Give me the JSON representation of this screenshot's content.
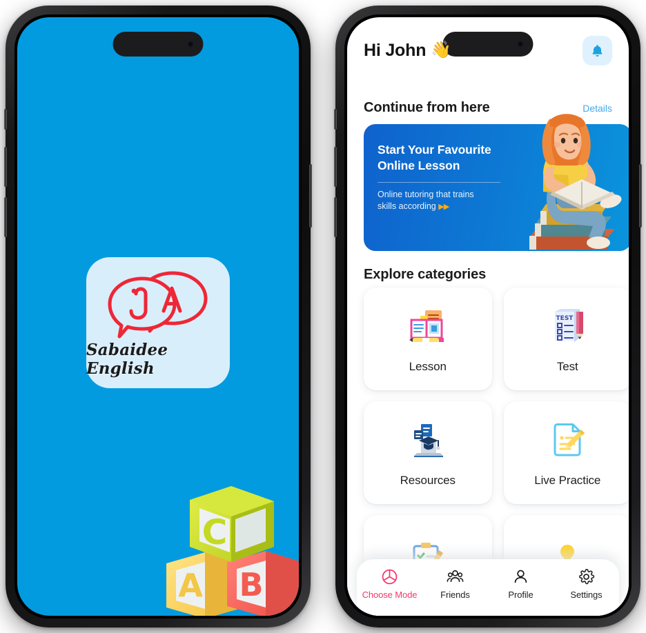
{
  "colors": {
    "splash_bg": "#039BE0",
    "logo_card_bg": "#d9eefb",
    "logo_red": "#ee2737",
    "banner_from": "#0f62cd",
    "banner_to": "#0a95dd",
    "accent_pink": "#f5376b",
    "link_blue": "#3fa9ee",
    "bell_bg": "#dff1fd",
    "arrow_amber": "#ffab14"
  },
  "splash": {
    "app_name": "Sabaidee English",
    "logo_letter_lao": "ບ",
    "logo_letter_en": "A",
    "blocks": [
      {
        "letter": "C",
        "color": "#c6d92a"
      },
      {
        "letter": "A",
        "color": "#ffd34e"
      },
      {
        "letter": "B",
        "color": "#ff6257"
      }
    ]
  },
  "app": {
    "header": {
      "greeting": "Hi John",
      "greeting_emoji": "👋",
      "notification_icon": "bell-icon"
    },
    "continue_section": {
      "title": "Continue from here",
      "details_label": "Details"
    },
    "banner": {
      "title_line1": "Start Your Favourite",
      "title_line2": "Online Lesson",
      "subtitle_line1": "Online tutoring that trains",
      "subtitle_line2": "skills according",
      "arrows": "▶▶",
      "illustration": "girl-reading-on-books"
    },
    "explore_section": {
      "title": "Explore categories"
    },
    "categories": [
      {
        "label": "Lesson",
        "icon": "open-book-notes-icon"
      },
      {
        "label": "Test",
        "icon": "test-paper-pencil-icon"
      },
      {
        "label": "Resources",
        "icon": "laptop-graduation-cap-icon"
      },
      {
        "label": "Live Practice",
        "icon": "document-pencil-icon"
      },
      {
        "label": "",
        "icon": "clipboard-checklist-pencil-icon"
      },
      {
        "label": "",
        "icon": "book-lightbulb-icon"
      }
    ],
    "bottom_nav": [
      {
        "label": "Choose Mode",
        "icon": "pie-chart-icon",
        "active": true
      },
      {
        "label": "Friends",
        "icon": "people-group-icon",
        "active": false
      },
      {
        "label": "Profile",
        "icon": "person-icon",
        "active": false
      },
      {
        "label": "Settings",
        "icon": "gear-icon",
        "active": false
      }
    ]
  }
}
